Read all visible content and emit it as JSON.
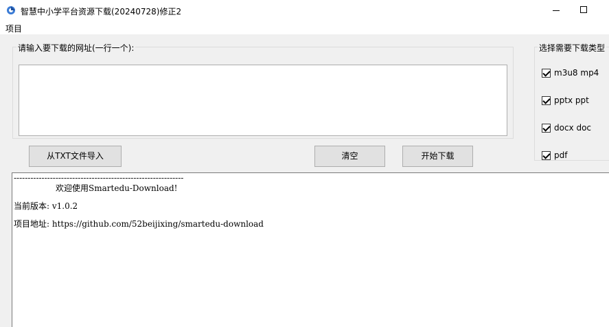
{
  "window": {
    "title": "智慧中小学平台资源下载(20240728)修正2"
  },
  "menu": {
    "items": [
      "项目"
    ]
  },
  "url_group": {
    "label": "请输入要下载的网址(一行一个):",
    "value": ""
  },
  "type_group": {
    "label": "选择需要下载类型",
    "options": [
      {
        "label": "m3u8 mp4",
        "checked": true
      },
      {
        "label": "pptx ppt",
        "checked": true
      },
      {
        "label": "docx doc",
        "checked": true
      },
      {
        "label": "pdf",
        "checked": true
      }
    ]
  },
  "buttons": {
    "import": "从TXT文件导入",
    "clear": "清空",
    "download": "开始下载"
  },
  "log": {
    "lines": [
      "-------------------------------------------------------------",
      "                欢迎使用Smartedu-Download!",
      "当前版本: v1.0.2",
      "项目地址: https://github.com/52beijixing/smartedu-download"
    ]
  }
}
